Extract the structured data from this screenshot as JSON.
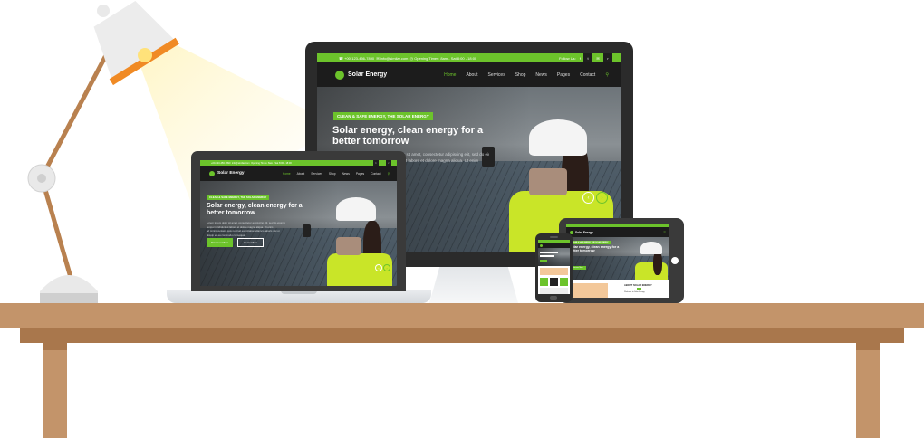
{
  "site": {
    "phone": "+00-123-456-7890",
    "email": "info@similar.com",
    "hours": "Opening Times: 8am - Sat 8:00 - 18:00",
    "follow": "Follow Us:",
    "logo": "Solar Energy",
    "nav": [
      "Home",
      "About",
      "Services",
      "Shop",
      "News",
      "Pages",
      "Contact"
    ],
    "badge": "CLEAN & SAFE ENERGY, THE SOLAR ENERGY",
    "title_line1": "Solar energy, clean energy for a",
    "title_line2": "better tomorrow",
    "text_line1": "Lorem ipsum dolor sit amet, consectetur adipiscing elit, sed do eiusmo",
    "text_line2": "tempor incididunt ut labore et dolore magna aliqua. Ut enim",
    "text_line3": "ad minim veniam, quis nostrud exercitation ullamco laboris nisi ut",
    "text_line4": "aliquip ex ea commodo consequat.",
    "btn_primary": "Discover More",
    "btn_secondary": "Learn More",
    "about_title": "ABOUT SOLAR ENERGY",
    "about_sub": "Welcome to Solar Energy"
  },
  "colors": {
    "accent": "#6cc32b",
    "desk": "#c3946a",
    "lamp_shade": "#ebebeb",
    "lamp_rim": "#f08a24"
  },
  "icons": [
    "phone-icon",
    "mail-icon",
    "clock-icon",
    "facebook-icon",
    "twitter-icon",
    "mail-social-icon",
    "rss-icon",
    "search-icon",
    "chevron-left-icon",
    "chevron-right-icon"
  ]
}
